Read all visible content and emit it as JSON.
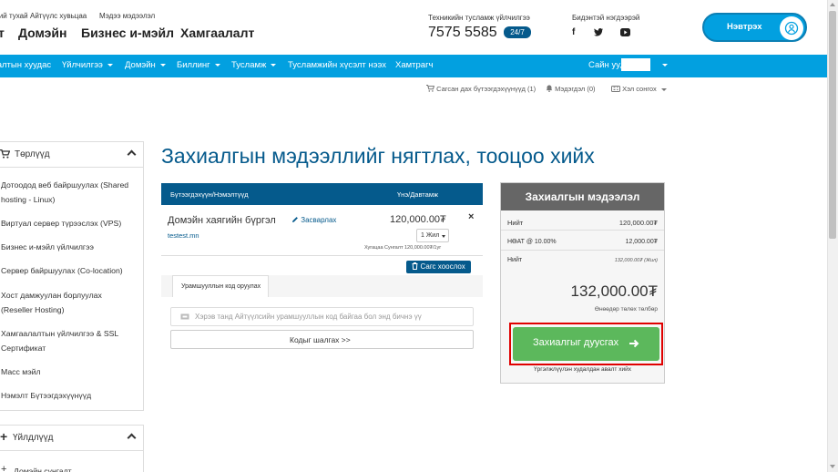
{
  "header": {
    "top_links": [
      "Бидний тухай",
      "Айтүүлс хувьцаа",
      "Мэдээ мэдээлэл"
    ],
    "main_nav": [
      "Домэйн",
      "Бизнес и-мэйл",
      "Хамгаалалт"
    ],
    "support_label": "Техникийн тусламж үйлчилгээ",
    "support_phone": "7575 5585",
    "support_badge": "24/7",
    "social_label": "Бидэнтэй нэгдээрэй",
    "login_label": "Нэвтрэх"
  },
  "navbar": {
    "items": [
      "Хяналтын хуудас",
      "Үйлчилгээ",
      "Домэйн",
      "Биллинг",
      "Тусламж",
      "Тусламжийн хүсэлт нээх",
      "Хамтрагч"
    ],
    "user_greeting": "Сайн уу,"
  },
  "subbar": {
    "cart": "Сагсан дах бүтээгдэхүүнүүд (1)",
    "notifications": "Мэдэгдэл (0)",
    "language": "Хэл сонгох"
  },
  "sidebar": {
    "categories_title": "Төрлүүд",
    "categories": [
      [
        "Дотоодод веб байршуулах (Shared",
        "hosting - Linux)"
      ],
      [
        "Виртуал сервер түрээслэх (VPS)"
      ],
      [
        "Бизнес и-мэйл үйлчилгээ"
      ],
      [
        "Сервер байршуулах (Co-location)"
      ],
      [
        "Хост дамжуулан борлуулах",
        "(Reseller Hosting)"
      ],
      [
        "Хамгаалалтын үйлчилгээ & SSL",
        "Сертификат"
      ],
      [
        "Масс мэйл"
      ],
      [
        "Нэмэлт Бүтээгдэхүүнүүд"
      ]
    ],
    "actions_title": "Үйлдлүүд",
    "actions": [
      "Домэйн сунгалт"
    ]
  },
  "main": {
    "title": "Захиалгын мэдээллийг нягтлах, тооцоо хийх",
    "table_head_product": "Бүтээгдэхүүн/Нэмэлтүүд",
    "table_head_price": "Үнэ/Давтамж",
    "item_name": "Домэйн хаягийн бүргэл",
    "edit_label": "Засварлах",
    "item_domain": "testest.mn",
    "item_price": "120,000.00₮",
    "period": "1 Жил",
    "period_note": "Хугацаа Сунгалт 120,000.00₮/1уг",
    "empty_cart": "Сагс хоослох",
    "promo_tab": "Урамшууллын код оруулах",
    "promo_placeholder": "Хэрэв танд Айтүүлсийн урамшууллын код байгаа бол энд бичнэ үү",
    "promo_button": "Кодыг шалгах >>"
  },
  "summary": {
    "title": "Захиалгын мэдээлэл",
    "rows": [
      {
        "label": "Нийт",
        "value": "120,000.00₮"
      },
      {
        "label": "НӨАТ @ 10.00%",
        "value": "12,000.00₮"
      },
      {
        "label": "Нийт",
        "value": "132,000.00₮ (Жил)"
      }
    ],
    "total": "132,000.00₮",
    "total_note": "Өнөөдөр төлөх төлбөр",
    "checkout": "Захиалгыг дуусгах",
    "continue": "Үргэлжлүүлэн худалдан авалт хийх"
  },
  "colors": {
    "accent": "#02a0e0",
    "dark_blue": "#055a8c",
    "green": "#5cb85c",
    "highlight": "#e00000"
  }
}
